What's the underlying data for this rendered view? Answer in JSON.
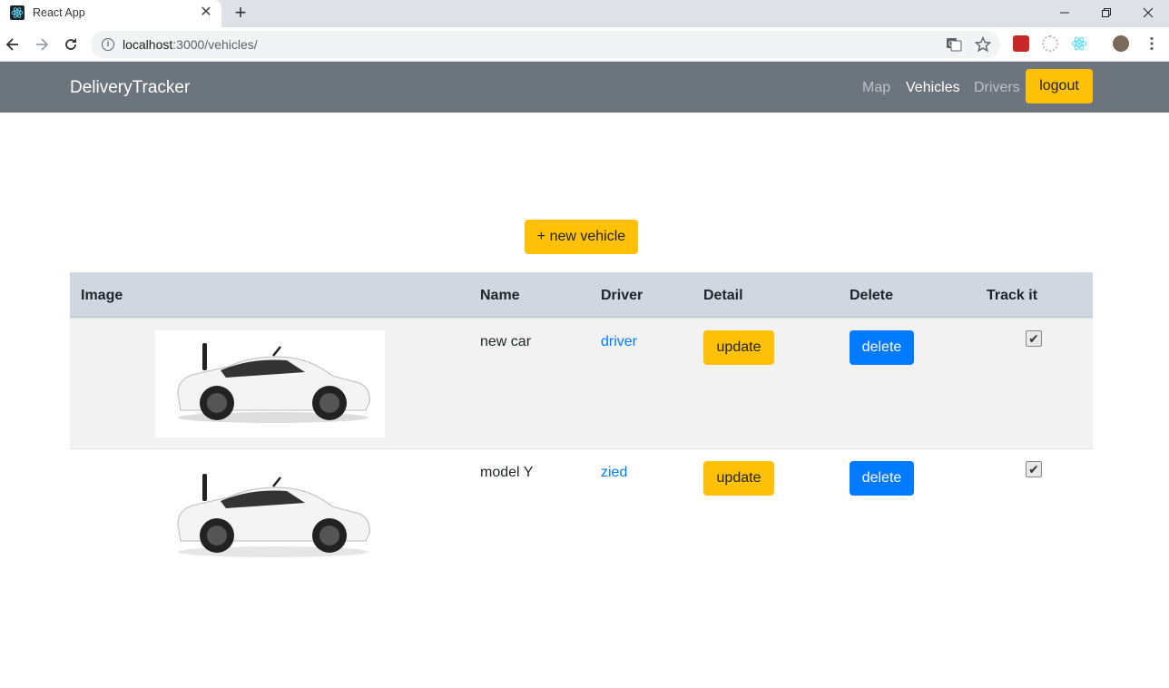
{
  "browser": {
    "tab_title": "React App",
    "url_host": "localhost",
    "url_rest": ":3000/vehicles/",
    "tab_close_glyph": "✕",
    "new_tab_glyph": "+"
  },
  "navbar": {
    "brand": "DeliveryTracker",
    "links": [
      {
        "label": "Map",
        "active": false
      },
      {
        "label": "Vehicles",
        "active": true
      },
      {
        "label": "Drivers",
        "active": false
      }
    ],
    "logout_label": "logout"
  },
  "actions": {
    "new_vehicle_label": "+ new vehicle"
  },
  "table": {
    "headers": [
      "Image",
      "Name",
      "Driver",
      "Detail",
      "Delete",
      "Track it"
    ],
    "rows": [
      {
        "name": "new car",
        "driver": "driver",
        "update_label": "update",
        "delete_label": "delete",
        "tracked": true
      },
      {
        "name": "model Y",
        "driver": "zied",
        "update_label": "update",
        "delete_label": "delete",
        "tracked": true
      }
    ]
  },
  "colors": {
    "navbar_bg": "#6c757d",
    "warning": "#ffc107",
    "primary": "#007bff",
    "table_header_bg": "#d0d7e1"
  }
}
